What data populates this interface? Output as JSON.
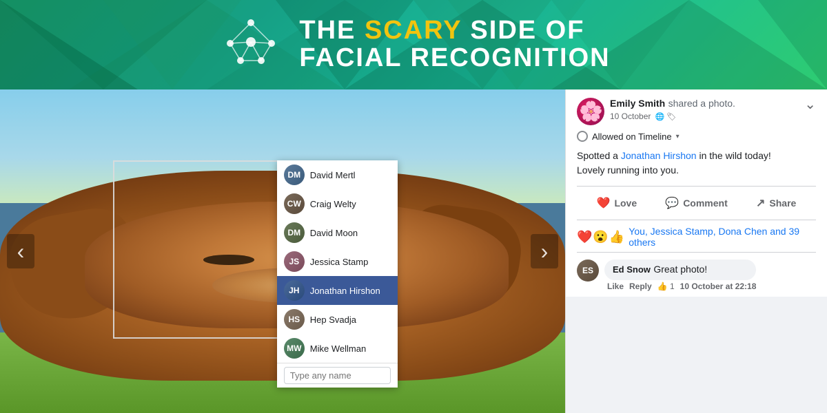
{
  "header": {
    "title_line1_pre": "THE ",
    "title_scary": "SCARY",
    "title_line1_post": " SIDE OF",
    "title_line2": "FACIAL RECOGNITION"
  },
  "photo": {
    "face_detection_label": "Face detection box"
  },
  "person_list": {
    "items": [
      {
        "id": "david-mertl",
        "name": "David Mertl",
        "initials": "DM",
        "selected": false
      },
      {
        "id": "craig-welty",
        "name": "Craig Welty",
        "initials": "CW",
        "selected": false
      },
      {
        "id": "david-moon",
        "name": "David Moon",
        "initials": "DM2",
        "selected": false
      },
      {
        "id": "jessica-stamp",
        "name": "Jessica Stamp",
        "initials": "JS",
        "selected": false
      },
      {
        "id": "jonathan-hirshon",
        "name": "Jonathan Hirshon",
        "initials": "JH",
        "selected": true
      },
      {
        "id": "hep-svadja",
        "name": "Hep Svadja",
        "initials": "HS",
        "selected": false
      },
      {
        "id": "mike-wellman",
        "name": "Mike Wellman",
        "initials": "MW",
        "selected": false
      }
    ],
    "input_placeholder": "Type any name"
  },
  "nav": {
    "left_arrow": "‹",
    "right_arrow": "›"
  },
  "fb_post": {
    "poster_name": "Emily Smith",
    "action": "shared a photo.",
    "date": "10 October",
    "timeline_label": "Allowed on Timeline",
    "body_pre": "Spotted a ",
    "body_mention": "Jonathan Hirshon",
    "body_post": " in the wild today!\nLovely running into you.",
    "love_label": "Love",
    "comment_label": "Comment",
    "share_label": "Share",
    "reactions": {
      "emojis": [
        "❤️",
        "😮",
        "🔵"
      ],
      "text": "You, Jessica Stamp, Dona Chen and 39 others"
    },
    "comments": [
      {
        "id": "ed-snow",
        "author": "Ed Snow",
        "text": "Great photo!",
        "meta_like": "Like",
        "meta_reply": "Reply",
        "meta_thumbs": "👍 1",
        "meta_date": "10 October at 22:18"
      }
    ]
  }
}
